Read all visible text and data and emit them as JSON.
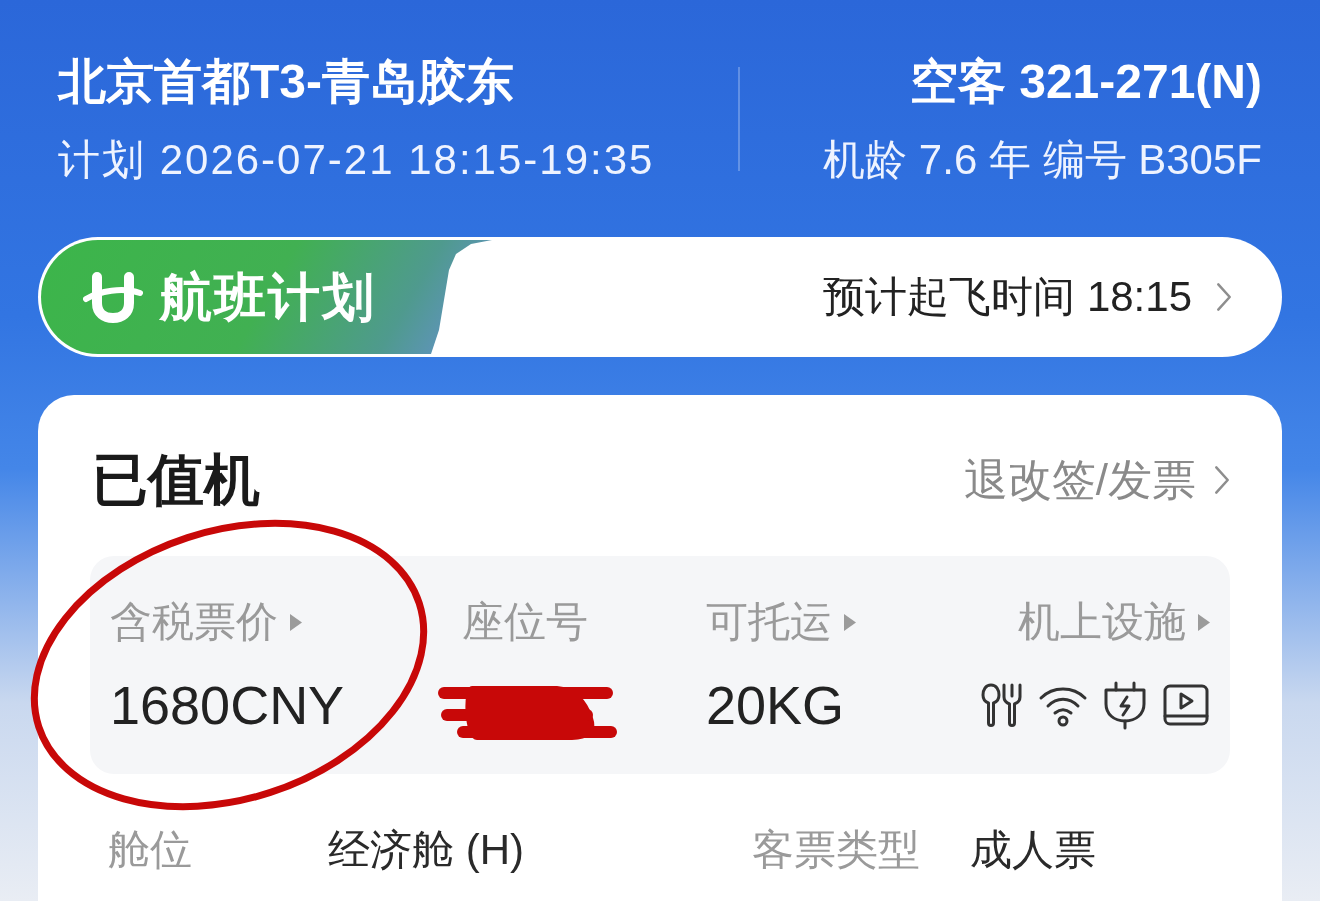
{
  "header": {
    "route": "北京首都T3-青岛胶东",
    "schedule": "计划 2026-07-21 18:15-19:35",
    "aircraft": "空客 321-271(N)",
    "details": "机龄 7.6 年 编号 B305F"
  },
  "banner": {
    "badge": "航班计划",
    "departure": "预计起飞时间 18:15"
  },
  "card": {
    "status": "已值机",
    "link": "退改签/发票",
    "info": [
      {
        "kind": "text",
        "label": "含税票价",
        "arrow": true,
        "value": "1680CNY",
        "circled": true,
        "redacted": false
      },
      {
        "kind": "text",
        "label": "座位号",
        "arrow": false,
        "circled": false,
        "redacted": true
      },
      {
        "kind": "text",
        "label": "可托运",
        "arrow": true,
        "value": "20KG",
        "circled": false,
        "redacted": false
      },
      {
        "kind": "icons",
        "label": "机上设施",
        "arrow": true,
        "circled": false,
        "redacted": false
      }
    ],
    "details": [
      {
        "label": "舱位",
        "value": "经济舱 (H)"
      },
      {
        "label": "客票类型",
        "value": "成人票"
      }
    ]
  }
}
